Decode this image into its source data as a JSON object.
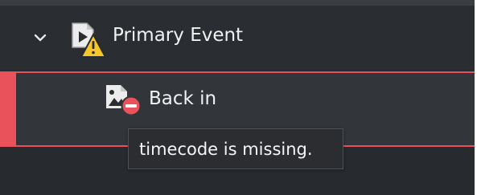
{
  "tree": {
    "parent": {
      "label": "Primary Event",
      "expanded": true,
      "icon": "video-warning-icon",
      "status": "warning"
    },
    "child": {
      "label": "Back in",
      "icon": "image-error-icon",
      "status": "error"
    }
  },
  "tooltip": {
    "text": "timecode is missing."
  },
  "colors": {
    "background": "#272a2e",
    "selected_row": "#323539",
    "error_accent": "#e9525a",
    "warning": "#f7c629",
    "text": "#f1f1f1"
  }
}
